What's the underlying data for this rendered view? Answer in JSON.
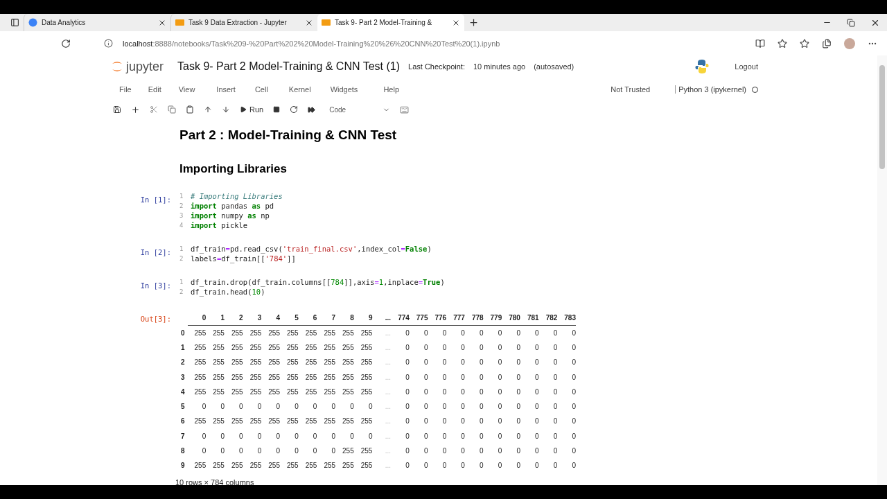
{
  "browser": {
    "tabs": [
      {
        "title": "Data Analytics",
        "selected": false,
        "kind": "web"
      },
      {
        "title": "Task 9 Data Extraction - Jupyter",
        "selected": false,
        "kind": "notebook"
      },
      {
        "title": "Task 9- Part 2 Model-Training &",
        "selected": true,
        "kind": "notebook"
      }
    ],
    "address": {
      "host": "localhost",
      "path": ":8888/notebooks/Task%209-%20Part%202%20Model-Training%20%26%20CNN%20Test%20(1).ipynb"
    }
  },
  "header": {
    "logo": "jupyter",
    "title": "Task 9- Part 2 Model-Training & CNN Test (1)",
    "checkpoint_label": "Last Checkpoint:",
    "checkpoint_time": "10 minutes ago",
    "autosave": "(autosaved)",
    "logout": "Logout"
  },
  "menu": [
    "File",
    "Edit",
    "View",
    "Insert",
    "Cell",
    "Kernel",
    "Widgets",
    "Help"
  ],
  "trust": "Not Trusted",
  "kernel": "Python 3 (ipykernel)",
  "kernel_busy": false,
  "toolbar": {
    "run": "Run",
    "cell_type": "Code"
  },
  "cells": [
    {
      "kind": "title",
      "text": "Part 2 : Model-Training & CNN Test"
    },
    {
      "kind": "section",
      "text": "Importing Libraries"
    },
    {
      "kind": "code",
      "prompt": "In [1]:",
      "lines": [
        {
          "number": "1",
          "tokens": [
            {
              "t": "# Importing Libraries",
              "kind": "comment"
            }
          ]
        },
        {
          "number": "2",
          "tokens": [
            {
              "t": "import",
              "kind": "keyword"
            },
            {
              "t": " pandas ",
              "kind": "plain"
            },
            {
              "t": "as",
              "kind": "keyword"
            },
            {
              "t": " pd",
              "kind": "plain"
            }
          ]
        },
        {
          "number": "3",
          "tokens": [
            {
              "t": "import",
              "kind": "keyword"
            },
            {
              "t": " numpy ",
              "kind": "plain"
            },
            {
              "t": "as",
              "kind": "keyword"
            },
            {
              "t": " np",
              "kind": "plain"
            }
          ]
        },
        {
          "number": "4",
          "tokens": [
            {
              "t": "import",
              "kind": "keyword"
            },
            {
              "t": " pickle",
              "kind": "plain"
            }
          ]
        }
      ]
    },
    {
      "kind": "code",
      "prompt": "In [2]:",
      "lines": [
        {
          "number": "1",
          "tokens": [
            {
              "t": "df_train",
              "kind": "plain"
            },
            {
              "t": "=",
              "kind": "operator"
            },
            {
              "t": "pd.read_csv(",
              "kind": "plain"
            },
            {
              "t": "'train_final.csv'",
              "kind": "string"
            },
            {
              "t": ",index_col",
              "kind": "plain"
            },
            {
              "t": "=",
              "kind": "operator"
            },
            {
              "t": "False",
              "kind": "keyword"
            },
            {
              "t": ")",
              "kind": "plain"
            }
          ]
        },
        {
          "number": "2",
          "tokens": [
            {
              "t": "labels",
              "kind": "plain"
            },
            {
              "t": "=",
              "kind": "operator"
            },
            {
              "t": "df_train[[",
              "kind": "plain"
            },
            {
              "t": "'784'",
              "kind": "string"
            },
            {
              "t": "]]",
              "kind": "plain"
            }
          ]
        }
      ]
    },
    {
      "kind": "code",
      "prompt": "In [3]:",
      "lines": [
        {
          "number": "1",
          "tokens": [
            {
              "t": "df_train.drop(df_train.columns[[",
              "kind": "plain"
            },
            {
              "t": "784",
              "kind": "number"
            },
            {
              "t": "]],axis",
              "kind": "plain"
            },
            {
              "t": "=",
              "kind": "operator"
            },
            {
              "t": "1",
              "kind": "number"
            },
            {
              "t": ",inplace",
              "kind": "plain"
            },
            {
              "t": "=",
              "kind": "operator"
            },
            {
              "t": "True",
              "kind": "keyword"
            },
            {
              "t": ")",
              "kind": "plain"
            }
          ]
        },
        {
          "number": "2",
          "tokens": [
            {
              "t": "df_train.head(",
              "kind": "plain"
            },
            {
              "t": "10",
              "kind": "number"
            },
            {
              "t": ")",
              "kind": "plain"
            }
          ]
        }
      ]
    },
    {
      "kind": "output",
      "prompt": "Out[3]:",
      "table": {
        "columns": [
          "0",
          "1",
          "2",
          "3",
          "4",
          "5",
          "6",
          "7",
          "8",
          "9",
          "...",
          "774",
          "775",
          "776",
          "777",
          "778",
          "779",
          "780",
          "781",
          "782",
          "783"
        ],
        "rows": [
          {
            "index": "0",
            "cells": [
              "255",
              "255",
              "255",
              "255",
              "255",
              "255",
              "255",
              "255",
              "255",
              "255",
              "...",
              "0",
              "0",
              "0",
              "0",
              "0",
              "0",
              "0",
              "0",
              "0",
              "0"
            ]
          },
          {
            "index": "1",
            "cells": [
              "255",
              "255",
              "255",
              "255",
              "255",
              "255",
              "255",
              "255",
              "255",
              "255",
              "...",
              "0",
              "0",
              "0",
              "0",
              "0",
              "0",
              "0",
              "0",
              "0",
              "0"
            ]
          },
          {
            "index": "2",
            "cells": [
              "255",
              "255",
              "255",
              "255",
              "255",
              "255",
              "255",
              "255",
              "255",
              "255",
              "...",
              "0",
              "0",
              "0",
              "0",
              "0",
              "0",
              "0",
              "0",
              "0",
              "0"
            ]
          },
          {
            "index": "3",
            "cells": [
              "255",
              "255",
              "255",
              "255",
              "255",
              "255",
              "255",
              "255",
              "255",
              "255",
              "...",
              "0",
              "0",
              "0",
              "0",
              "0",
              "0",
              "0",
              "0",
              "0",
              "0"
            ]
          },
          {
            "index": "4",
            "cells": [
              "255",
              "255",
              "255",
              "255",
              "255",
              "255",
              "255",
              "255",
              "255",
              "255",
              "...",
              "0",
              "0",
              "0",
              "0",
              "0",
              "0",
              "0",
              "0",
              "0",
              "0"
            ]
          },
          {
            "index": "5",
            "cells": [
              "0",
              "0",
              "0",
              "0",
              "0",
              "0",
              "0",
              "0",
              "0",
              "0",
              "...",
              "0",
              "0",
              "0",
              "0",
              "0",
              "0",
              "0",
              "0",
              "0",
              "0"
            ]
          },
          {
            "index": "6",
            "cells": [
              "255",
              "255",
              "255",
              "255",
              "255",
              "255",
              "255",
              "255",
              "255",
              "255",
              "...",
              "0",
              "0",
              "0",
              "0",
              "0",
              "0",
              "0",
              "0",
              "0",
              "0"
            ]
          },
          {
            "index": "7",
            "cells": [
              "0",
              "0",
              "0",
              "0",
              "0",
              "0",
              "0",
              "0",
              "0",
              "0",
              "...",
              "0",
              "0",
              "0",
              "0",
              "0",
              "0",
              "0",
              "0",
              "0",
              "0"
            ]
          },
          {
            "index": "8",
            "cells": [
              "0",
              "0",
              "0",
              "0",
              "0",
              "0",
              "0",
              "0",
              "255",
              "255",
              "...",
              "0",
              "0",
              "0",
              "0",
              "0",
              "0",
              "0",
              "0",
              "0",
              "0"
            ]
          },
          {
            "index": "9",
            "cells": [
              "255",
              "255",
              "255",
              "255",
              "255",
              "255",
              "255",
              "255",
              "255",
              "255",
              "...",
              "0",
              "0",
              "0",
              "0",
              "0",
              "0",
              "0",
              "0",
              "0",
              "0"
            ]
          }
        ],
        "shape": "10 rows × 784 columns"
      }
    }
  ]
}
